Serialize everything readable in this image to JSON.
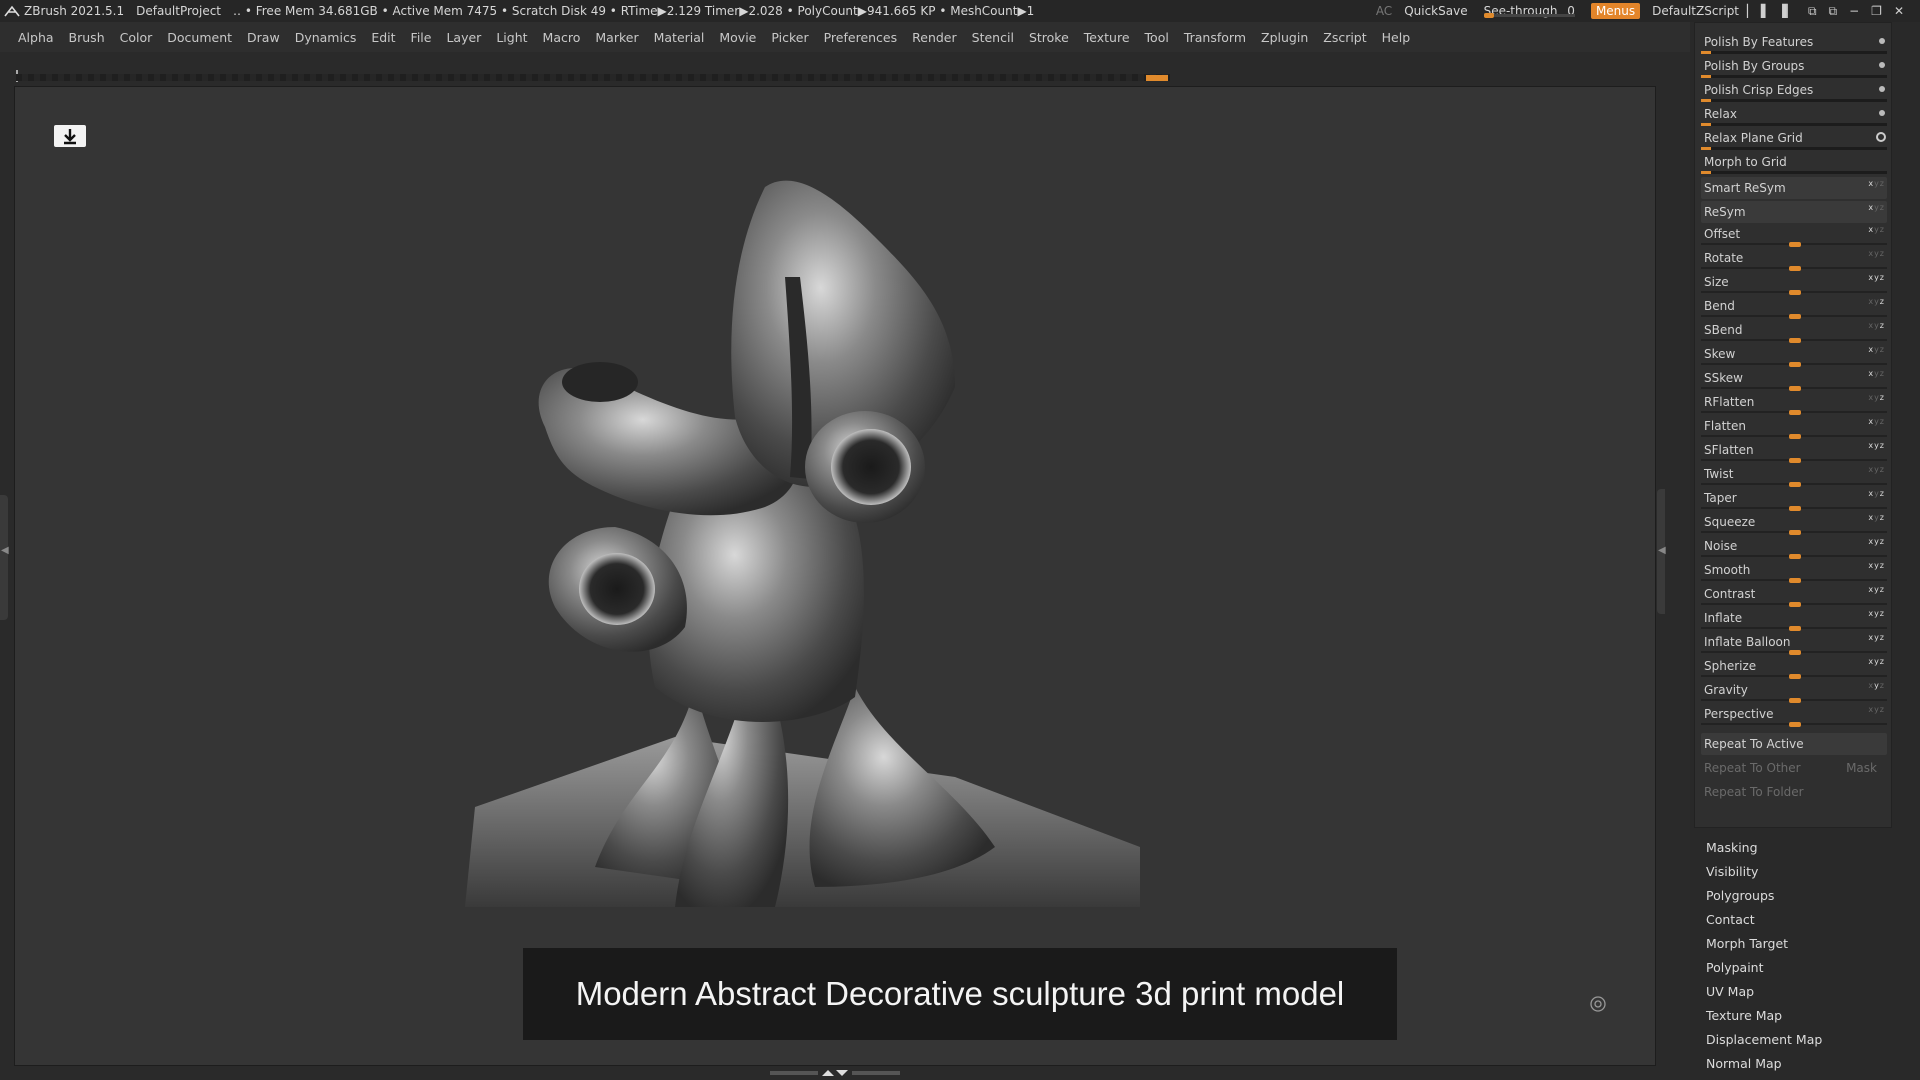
{
  "titlebar": {
    "app": "ZBrush 2021.5.1",
    "project": "DefaultProject",
    "stats": "‥ • Free Mem 34.681GB • Active Mem 7475 • Scratch Disk 49 •  RTime▶2.129 Timer▶2.028 • PolyCount▶941.665 KP  • MeshCount▶1",
    "ac": "AC",
    "quicksave": "QuickSave",
    "seethrough_label": "See-through",
    "seethrough_value": "0",
    "menus": "Menus",
    "script": "DefaultZScript",
    "accent": "#e3852a"
  },
  "menubar": [
    "Alpha",
    "Brush",
    "Color",
    "Document",
    "Draw",
    "Dynamics",
    "Edit",
    "File",
    "Layer",
    "Light",
    "Macro",
    "Marker",
    "Material",
    "Movie",
    "Picker",
    "Preferences",
    "Render",
    "Stencil",
    "Stroke",
    "Texture",
    "Tool",
    "Transform",
    "Zplugin",
    "Zscript",
    "Help"
  ],
  "viewport": {
    "caption": "Modern Abstract Decorative sculpture 3d print model",
    "corner_icon": "download-icon",
    "target_icon": "target-icon"
  },
  "deformation": {
    "top_items": [
      {
        "label": "Polish By Features",
        "control": "dot"
      },
      {
        "label": "Polish By Groups",
        "control": "dot"
      },
      {
        "label": "Polish Crisp Edges",
        "control": "dot"
      },
      {
        "label": "Relax",
        "control": "dot"
      },
      {
        "label": "Relax Plane Grid",
        "control": "ring"
      },
      {
        "label": "Morph to Grid",
        "control": "none"
      }
    ],
    "smart_resym": "Smart ReSym",
    "resym": "ReSym",
    "sliders": [
      {
        "label": "Offset",
        "axes": [
          1,
          0,
          0
        ]
      },
      {
        "label": "Rotate",
        "axes": [
          0,
          0,
          0
        ]
      },
      {
        "label": "Size",
        "axes": [
          1,
          1,
          1
        ]
      },
      {
        "label": "Bend",
        "axes": [
          0,
          0,
          1
        ]
      },
      {
        "label": "SBend",
        "axes": [
          0,
          0,
          1
        ]
      },
      {
        "label": "Skew",
        "axes": [
          1,
          0,
          0
        ]
      },
      {
        "label": "SSkew",
        "axes": [
          1,
          0,
          0
        ]
      },
      {
        "label": "RFlatten",
        "axes": [
          0,
          0,
          1
        ]
      },
      {
        "label": "Flatten",
        "axes": [
          1,
          0,
          0
        ]
      },
      {
        "label": "SFlatten",
        "axes": [
          1,
          1,
          1
        ]
      },
      {
        "label": "Twist",
        "axes": [
          0,
          0,
          0
        ]
      },
      {
        "label": "Taper",
        "axes": [
          1,
          0,
          1
        ]
      },
      {
        "label": "Squeeze",
        "axes": [
          1,
          0,
          1
        ]
      },
      {
        "label": "Noise",
        "axes": [
          1,
          1,
          1
        ]
      },
      {
        "label": "Smooth",
        "axes": [
          1,
          1,
          1
        ]
      },
      {
        "label": "Contrast",
        "axes": [
          1,
          1,
          1
        ]
      },
      {
        "label": "Inflate",
        "axes": [
          1,
          1,
          1
        ]
      },
      {
        "label": "Inflate Balloon",
        "axes": [
          1,
          1,
          1
        ]
      },
      {
        "label": "Spherize",
        "axes": [
          1,
          1,
          1
        ]
      },
      {
        "label": "Gravity",
        "axes": [
          0,
          1,
          0
        ]
      },
      {
        "label": "Perspective",
        "axes": [
          0,
          0,
          0
        ]
      }
    ],
    "repeat_active": "Repeat To Active",
    "repeat_other": "Repeat To Other",
    "mask": "Mask",
    "repeat_folder": "Repeat To Folder"
  },
  "subpalettes": [
    "Masking",
    "Visibility",
    "Polygroups",
    "Contact",
    "Morph Target",
    "Polypaint",
    "UV Map",
    "Texture Map",
    "Displacement Map",
    "Normal Map"
  ]
}
